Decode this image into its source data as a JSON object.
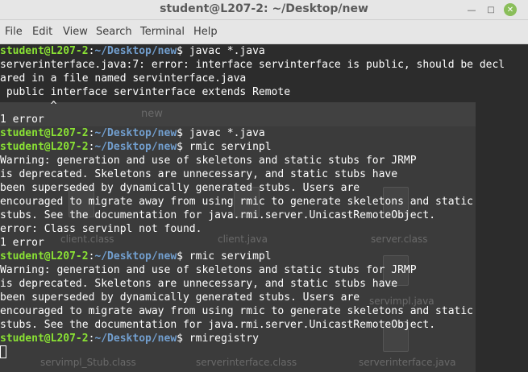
{
  "window": {
    "title": "student@L207-2: ~/Desktop/new",
    "minimize_icon": "minimize-icon",
    "maximize_icon": "maximize-icon",
    "close_icon": "close-icon",
    "close_color": "#8abe5a"
  },
  "menubar": {
    "items": [
      "File",
      "Edit",
      "View",
      "Search",
      "Terminal",
      "Help"
    ]
  },
  "colors": {
    "background": "#2c2c2c",
    "text": "#ffffff",
    "prompt_user": "#8ae234",
    "prompt_path": "#729fcf"
  },
  "background_window": {
    "title": "new",
    "files": [
      "client.class",
      "client.java",
      "server.class",
      "servimpl.java",
      "servimpl_Stub.class",
      "serverinterface.class",
      "serverinterface.java"
    ]
  },
  "terminal": {
    "lines": [
      {
        "type": "prompt",
        "user": "student@L207-2",
        "sep": ":",
        "path": "~/Desktop/new",
        "symbol": "$",
        "command": " javac *.java"
      },
      {
        "type": "text",
        "text": "serverinterface.java:7: error: interface servinterface is public, should be decl"
      },
      {
        "type": "text",
        "text": "ared in a file named servinterface.java"
      },
      {
        "type": "text",
        "text": " public interface servinterface extends Remote"
      },
      {
        "type": "text",
        "text": "        ^"
      },
      {
        "type": "text",
        "text": "1 error"
      },
      {
        "type": "prompt",
        "user": "student@L207-2",
        "sep": ":",
        "path": "~/Desktop/new",
        "symbol": "$",
        "command": " javac *.java"
      },
      {
        "type": "prompt",
        "user": "student@L207-2",
        "sep": ":",
        "path": "~/Desktop/new",
        "symbol": "$",
        "command": " rmic servinpl"
      },
      {
        "type": "text",
        "text": "Warning: generation and use of skeletons and static stubs for JRMP"
      },
      {
        "type": "text",
        "text": "is deprecated. Skeletons are unnecessary, and static stubs have"
      },
      {
        "type": "text",
        "text": "been superseded by dynamically generated stubs. Users are"
      },
      {
        "type": "text",
        "text": "encouraged to migrate away from using rmic to generate skeletons and static"
      },
      {
        "type": "text",
        "text": "stubs. See the documentation for java.rmi.server.UnicastRemoteObject."
      },
      {
        "type": "text",
        "text": "error: Class servinpl not found."
      },
      {
        "type": "text",
        "text": "1 error"
      },
      {
        "type": "prompt",
        "user": "student@L207-2",
        "sep": ":",
        "path": "~/Desktop/new",
        "symbol": "$",
        "command": " rmic servimpl"
      },
      {
        "type": "text",
        "text": "Warning: generation and use of skeletons and static stubs for JRMP"
      },
      {
        "type": "text",
        "text": "is deprecated. Skeletons are unnecessary, and static stubs have"
      },
      {
        "type": "text",
        "text": "been superseded by dynamically generated stubs. Users are"
      },
      {
        "type": "text",
        "text": "encouraged to migrate away from using rmic to generate skeletons and static"
      },
      {
        "type": "text",
        "text": "stubs. See the documentation for java.rmi.server.UnicastRemoteObject."
      },
      {
        "type": "prompt",
        "user": "student@L207-2",
        "sep": ":",
        "path": "~/Desktop/new",
        "symbol": "$",
        "command": " rmiregistry"
      },
      {
        "type": "cursor"
      }
    ]
  }
}
